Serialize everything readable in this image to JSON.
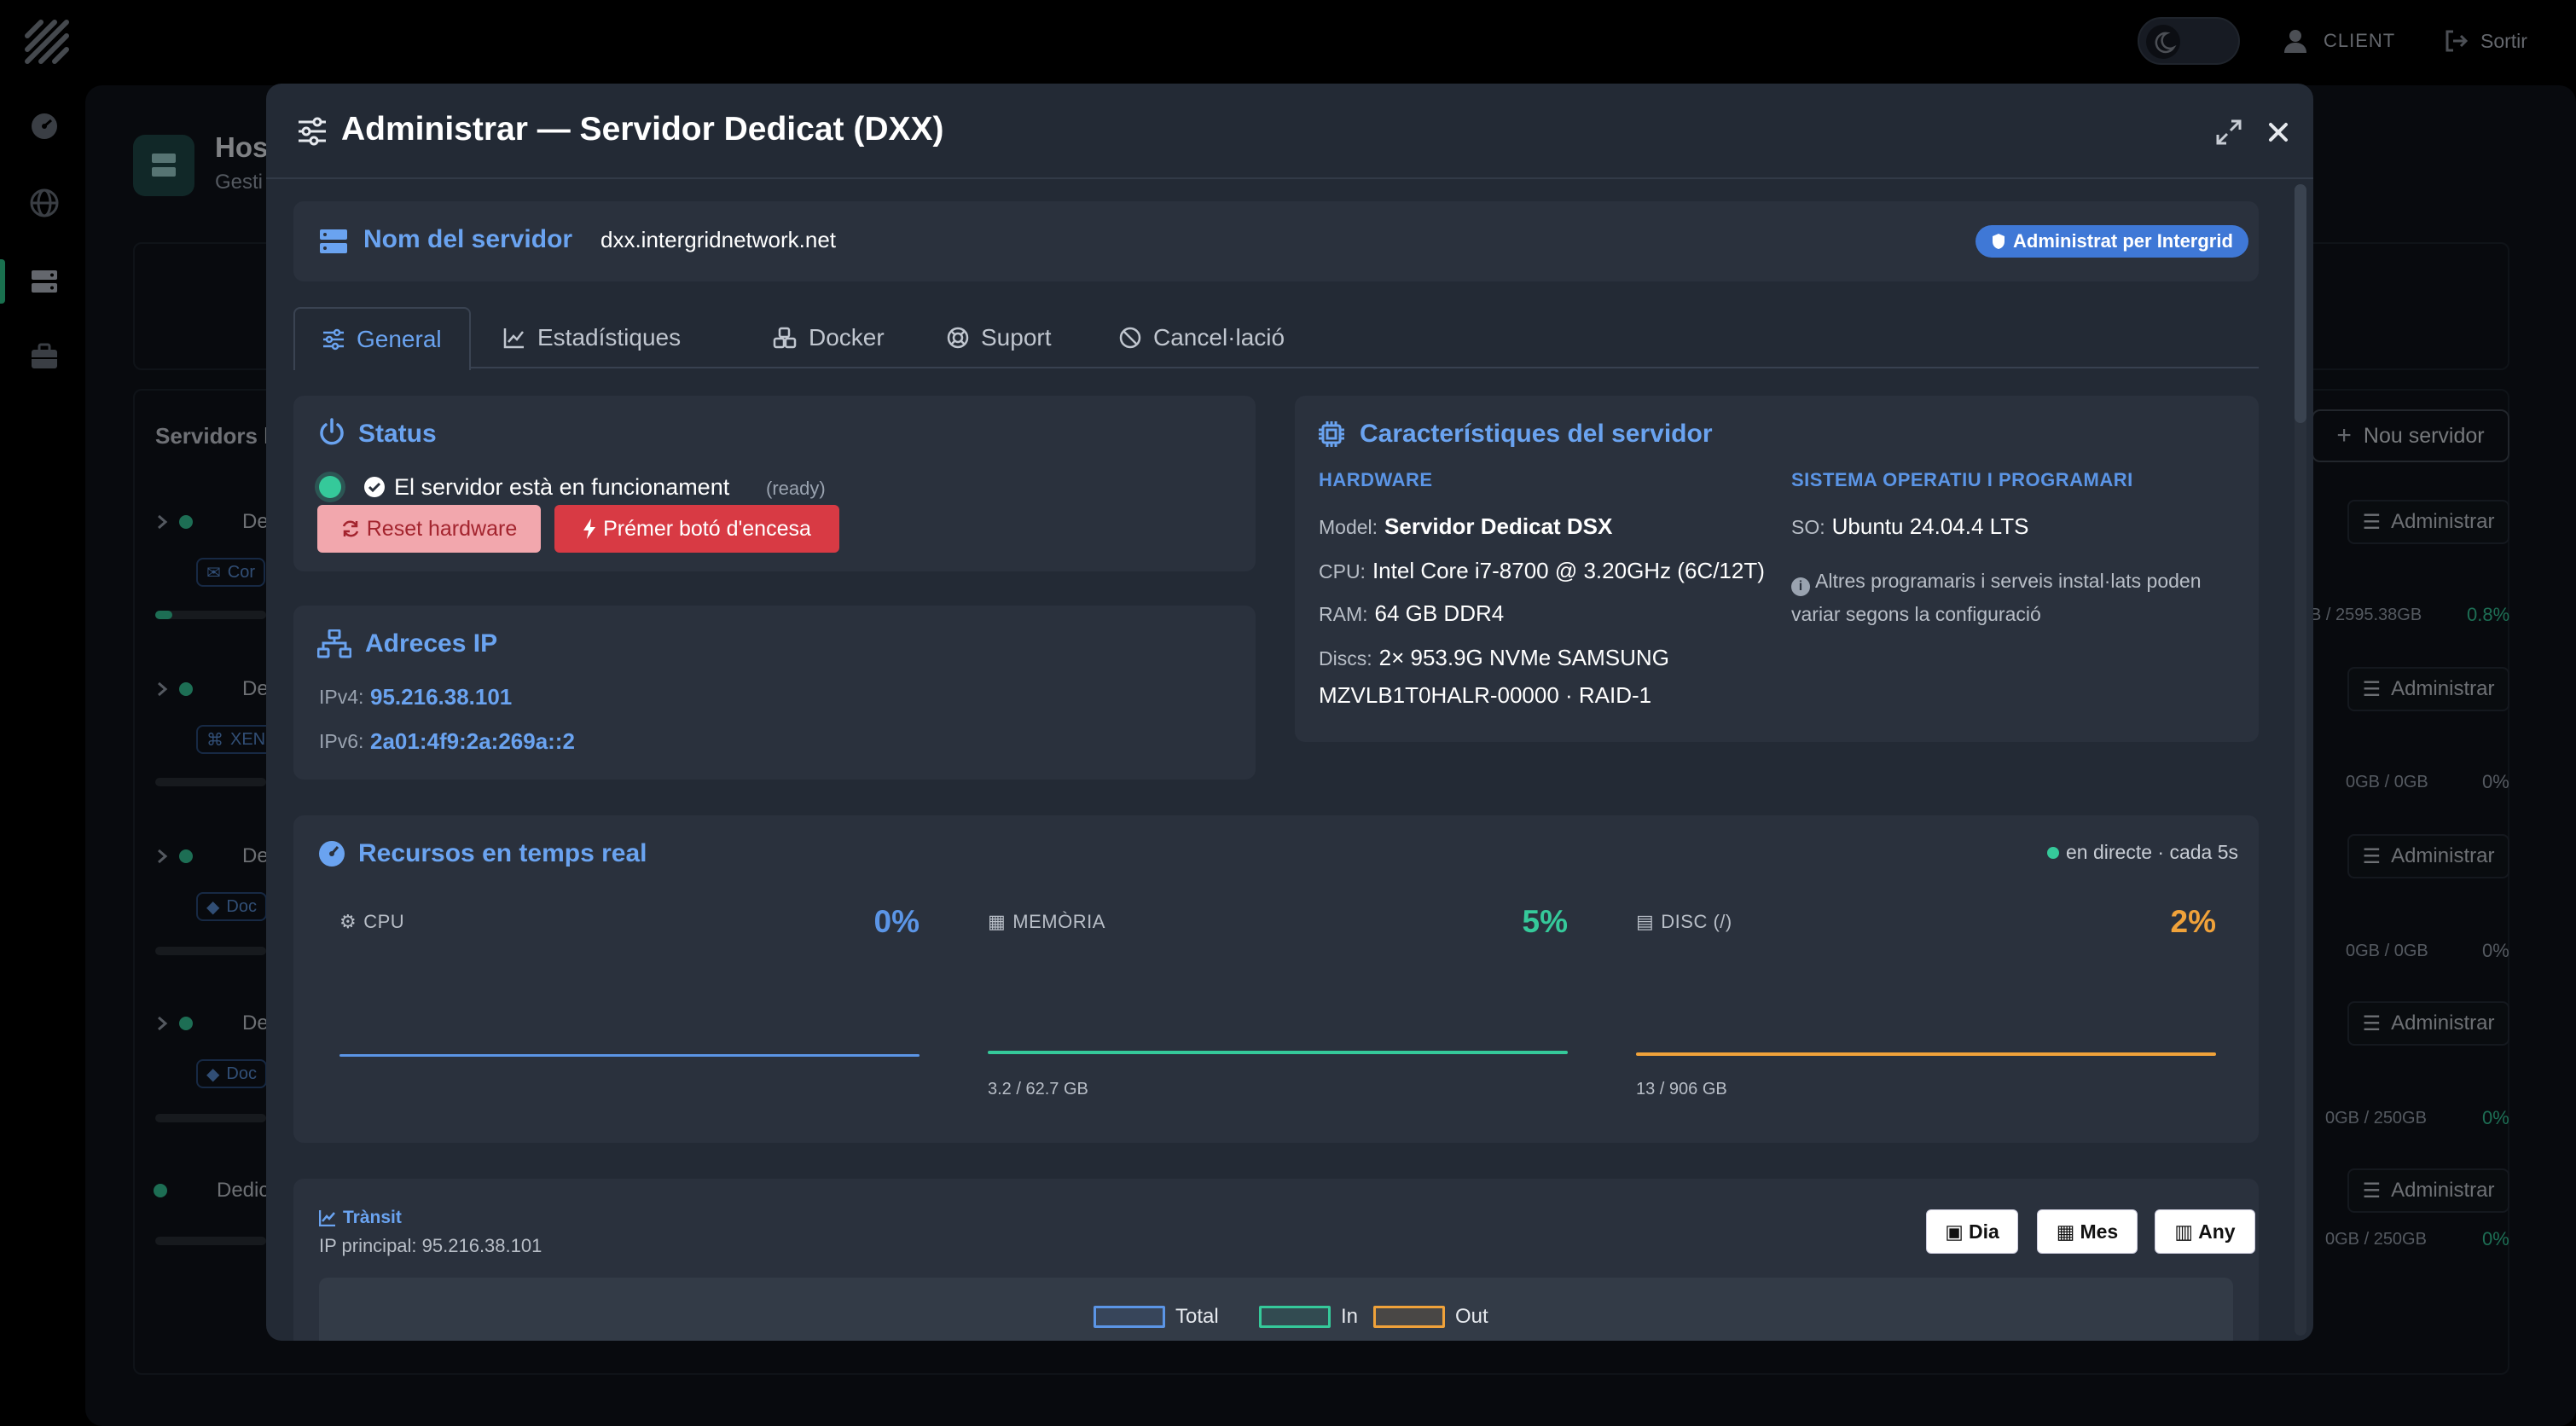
{
  "topbar": {
    "client_label": "CLIENT",
    "logout_label": "Sortir"
  },
  "background": {
    "title": "Host",
    "subtitle": "Gesti",
    "table_title": "Servidors l",
    "new_server_label": "Nou servidor",
    "admin_label": "Administrar",
    "rows": [
      {
        "label": "De",
        "tag": "Cor",
        "usage": "B / 2595.38GB",
        "pct": "0.8%"
      },
      {
        "label": "De",
        "tag": "XEN",
        "usage": "0GB / 0GB",
        "pct": "0%"
      },
      {
        "label": "De",
        "tag": "Doc",
        "usage": "0GB / 0GB",
        "pct": "0%"
      },
      {
        "label": "De",
        "tag": "Doc",
        "usage": "0GB / 250GB",
        "pct": "0%"
      },
      {
        "label": "Dedic",
        "tag": "",
        "usage": "0GB / 250GB",
        "pct": "0%"
      }
    ]
  },
  "modal": {
    "title": "Administrar — Servidor Dedicat (DXX)",
    "server_name_label": "Nom del servidor",
    "server_name": "dxx.intergridnetwork.net",
    "managed_badge": "Administrat per Intergrid",
    "tabs": [
      {
        "label": "General"
      },
      {
        "label": "Estadístiques"
      },
      {
        "label": "Docker"
      },
      {
        "label": "Suport"
      },
      {
        "label": "Cancel·lació"
      }
    ],
    "status": {
      "title": "Status",
      "text": "El servidor està en funcionament",
      "state": "(ready)",
      "reset_label": "Reset hardware",
      "power_label": "Prémer botó d'encesa"
    },
    "ip": {
      "title": "Adreces IP",
      "ipv4_key": "IPv4:",
      "ipv4": "95.216.38.101",
      "ipv6_key": "IPv6:",
      "ipv6": "2a01:4f9:2a:269a::2"
    },
    "features": {
      "title": "Característiques del servidor",
      "hardware_head": "HARDWARE",
      "model_key": "Model:",
      "model": "Servidor Dedicat DSX",
      "cpu_key": "CPU:",
      "cpu": "Intel Core i7-8700 @ 3.20GHz (6C/12T)",
      "ram_key": "RAM:",
      "ram": "64 GB DDR4",
      "discs_key": "Discs:",
      "discs_1": "2× 953.9G NVMe SAMSUNG",
      "discs_2": "MZVLB1T0HALR-00000 · RAID-1",
      "os_head": "SISTEMA OPERATIU I PROGRAMARI",
      "os_key": "SO:",
      "os": "Ubuntu 24.04.4 LTS",
      "note": "Altres programaris i serveis instal·lats poden variar segons la configuració"
    },
    "resources": {
      "title": "Recursos en temps real",
      "live": "en directe · cada 5s",
      "cpu_label": "CPU",
      "cpu_pct": "0%",
      "cpu_value": 0,
      "mem_label": "MEMÒRIA",
      "mem_pct": "5%",
      "mem_value": 5,
      "mem_detail": "3.2 / 62.7 GB",
      "disk_label": "DISC (/)",
      "disk_pct": "2%",
      "disk_value": 2,
      "disk_detail": "13 / 906 GB",
      "colors": {
        "cpu": "#5b95e6",
        "mem": "#35c99a",
        "disk": "#f0a23a"
      }
    },
    "traffic": {
      "title": "Trànsit",
      "ip_line": "IP principal: 95.216.38.101",
      "btn_day": "Dia",
      "btn_month": "Mes",
      "btn_year": "Any",
      "legend": [
        {
          "name": "Total",
          "color": "#5b95e6"
        },
        {
          "name": "In",
          "color": "#35c99a"
        },
        {
          "name": "Out",
          "color": "#f0a23a"
        }
      ]
    }
  }
}
